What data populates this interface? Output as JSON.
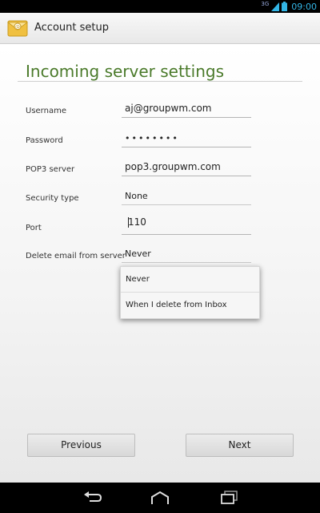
{
  "status_bar": {
    "network": "3G",
    "time": "09:00",
    "icons": [
      "signal-icon",
      "battery-icon"
    ]
  },
  "action_bar": {
    "title": "Account setup",
    "icon": "email-app-icon"
  },
  "page": {
    "heading": "Incoming server settings"
  },
  "form": {
    "username": {
      "label": "Username",
      "value": "aj@groupwm.com"
    },
    "password": {
      "label": "Password",
      "value": "••••••••"
    },
    "pop3_server": {
      "label": "POP3 server",
      "value": "pop3.groupwm.com"
    },
    "security_type": {
      "label": "Security type",
      "value": "None"
    },
    "port": {
      "label": "Port",
      "value": "110"
    },
    "delete_email": {
      "label": "Delete email from server",
      "value": "Never"
    }
  },
  "dropdown": {
    "options": [
      "Never",
      "When I delete from Inbox"
    ]
  },
  "buttons": {
    "previous": "Previous",
    "next": "Next"
  },
  "nav_bar": {
    "icons": [
      "back-icon",
      "home-icon",
      "recent-apps-icon"
    ]
  },
  "colors": {
    "heading": "#4a7a2a",
    "clock": "#33b5e5",
    "background": "#ffffff"
  }
}
